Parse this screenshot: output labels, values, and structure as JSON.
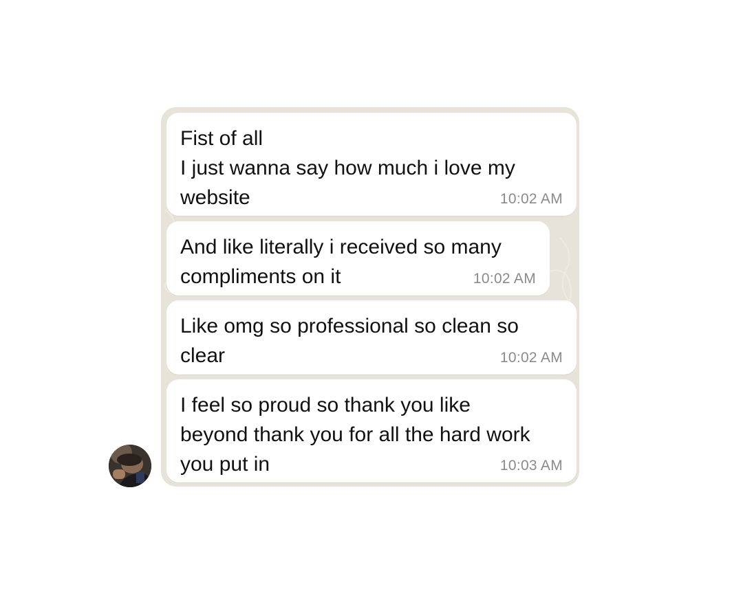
{
  "chat": {
    "messages": [
      {
        "text": "Fist of all\nI just wanna say how much i love my\nwebsite",
        "time": "10:02 AM"
      },
      {
        "text": "And like literally i received so many\ncompliments on it",
        "time": "10:02 AM"
      },
      {
        "text": "Like omg so professional so clean so\nclear",
        "time": "10:02 AM"
      },
      {
        "text": "I feel so proud so thank you like\nbeyond thank you for all the hard work\nyou put in",
        "time": "10:03 AM"
      }
    ],
    "colors": {
      "wallpaper": "#e8e3d9",
      "bubble": "#ffffff",
      "text": "#111111",
      "timestamp": "#8a8a8a"
    },
    "avatar_icon": "contact-photo"
  }
}
